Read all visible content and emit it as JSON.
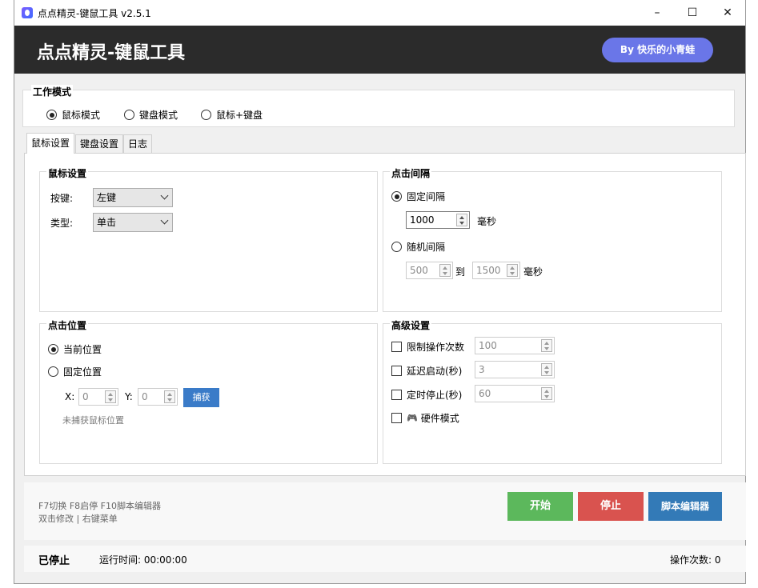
{
  "window": {
    "title": "点点精灵-键鼠工具 v2.5.1",
    "minimize": "–",
    "maximize": "☐",
    "close": "✕"
  },
  "header": {
    "title": "点点精灵-键鼠工具",
    "badge": "By 快乐的小青蛙"
  },
  "work_mode": {
    "legend": "工作模式",
    "options": [
      {
        "label": "鼠标模式",
        "selected": true
      },
      {
        "label": "键盘模式",
        "selected": false
      },
      {
        "label": "鼠标+键盘",
        "selected": false
      }
    ]
  },
  "tabs": [
    {
      "label": "鼠标设置",
      "active": true
    },
    {
      "label": "键盘设置",
      "active": false
    },
    {
      "label": "日志",
      "active": false
    }
  ],
  "mouse_settings": {
    "legend": "鼠标设置",
    "button_label": "按键:",
    "button_value": "左键",
    "type_label": "类型:",
    "type_value": "单击"
  },
  "click_interval": {
    "legend": "点击间隔",
    "fixed_label": "固定间隔",
    "fixed_selected": true,
    "fixed_value": "1000",
    "unit": "毫秒",
    "random_label": "随机间隔",
    "random_selected": false,
    "random_min": "500",
    "to": "到",
    "random_max": "1500"
  },
  "click_position": {
    "legend": "点击位置",
    "current_label": "当前位置",
    "current_selected": true,
    "fixed_label": "固定位置",
    "fixed_selected": false,
    "x_label": "X:",
    "x_value": "0",
    "y_label": "Y:",
    "y_value": "0",
    "capture_label": "捕获",
    "status": "未捕获鼠标位置"
  },
  "advanced": {
    "legend": "高级设置",
    "limit_label": "限制操作次数",
    "limit_value": "100",
    "delay_label": "延迟启动(秒)",
    "delay_value": "3",
    "stop_label": "定时停止(秒)",
    "stop_value": "60",
    "hardware_icon": "gamepad-icon",
    "hardware_glyph": "🎮",
    "hardware_label": "硬件模式"
  },
  "footer": {
    "hint1": "F7切换 F8启停 F10脚本编辑器",
    "hint2": "双击修改 | 右键菜单",
    "start_label": "开始",
    "stop_label": "停止",
    "editor_label": "脚本编辑器"
  },
  "status": {
    "state": "已停止",
    "runtime": "运行时间: 00:00:00",
    "count": "操作次数: 0"
  },
  "colors": {
    "header_bg": "#2b2b2b",
    "badge_bg": "#6a76e8",
    "capture_btn": "#3a7bc8",
    "start_btn": "#5cb85c",
    "stop_btn": "#d9534f",
    "editor_btn": "#337ab7"
  }
}
